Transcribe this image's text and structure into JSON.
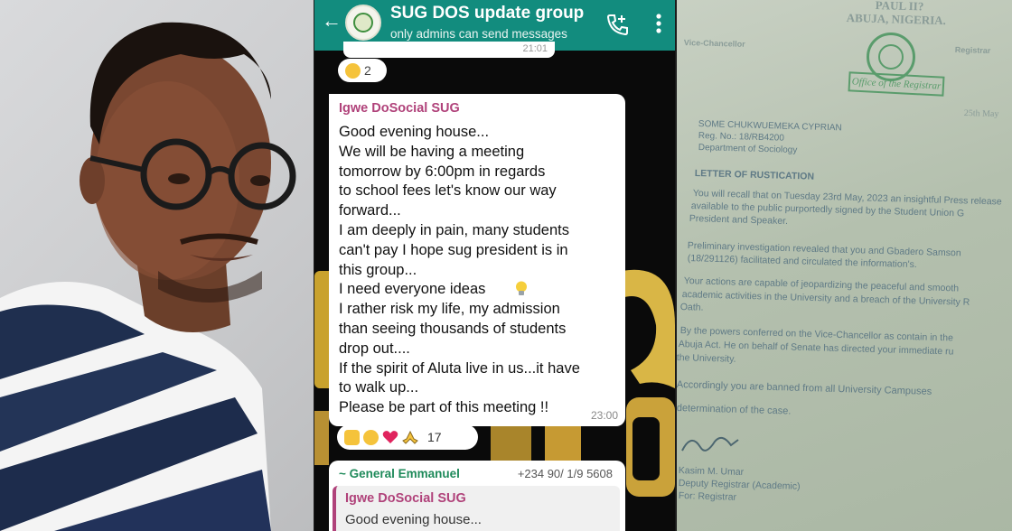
{
  "chat": {
    "header": {
      "group_name": "SUG DOS update group",
      "subtitle": "only admins can send messages"
    },
    "previous_message": {
      "time": "21:01"
    },
    "previous_reactions": {
      "emoji": "laughing-tears",
      "count": "2"
    },
    "message": {
      "sender": "Igwe DoSocial SUG",
      "text": "Good evening house...\nWe will be having a meeting\ntomorrow by 6:00pm in regards\nto school fees let's know our way\nforward...\nI am deeply in pain, many students\ncan't pay I hope sug president is in\nthis group...\nI need everyone ideas\nI rather risk my life, my admission\nthan seeing thousands of students\ndrop out....\nIf the spirit of Aluta live in us...it have\nto walk up...\nPlease be part of this meeting !!",
      "time": "23:00"
    },
    "reactions": {
      "emojis": [
        "thumbs-up",
        "laughing-tears",
        "heart",
        "praying-hands"
      ],
      "count": "17"
    },
    "reply": {
      "sender": "~ General Emmanuel",
      "phone": "+234 90/ 1/9 5608",
      "quoted_sender": "Igwe DoSocial SUG",
      "quoted_text": "Good evening house..."
    }
  },
  "letter": {
    "header_right": "PAUL II?",
    "city": "ABUJA, NIGERIA.",
    "office_stamp": "Office of the Registrar",
    "left_title": "Vice-Chancellor",
    "right_title": "Registrar",
    "date": "25th May",
    "addressee_name": "SOME CHUKWUEMEKA CYPRIAN",
    "reg_no": "Reg. No.: 18/RB4200",
    "department": "Department of Sociology",
    "subject": "LETTER OF RUSTICATION",
    "para1": [
      "You will recall that on Tuesday 23rd May, 2023 an insightful Press release",
      "available to the public purportedly signed by the Student Union G",
      "President and Speaker."
    ],
    "para2": [
      "Preliminary investigation revealed that you and Gbadero Samson",
      "(18/291126) facilitated and circulated the information's."
    ],
    "para3": [
      "Your actions are capable of jeopardizing the peaceful and smooth",
      "academic activities in the University and a breach of the University R",
      "Oath."
    ],
    "para4": [
      "By the powers conferred on the Vice-Chancellor as contain in the",
      "Abuja Act. He on behalf of Senate has directed your immediate ru",
      "the University."
    ],
    "para5": [
      "Accordingly you are banned from all University Campuses",
      "determination of the case."
    ],
    "signatory_name": "Kasim M. Umar",
    "signatory_title": "Deputy Registrar (Academic)",
    "signatory_for": "For: Registrar"
  },
  "colors": {
    "whatsapp_header": "#128c7e",
    "sender_pink": "#b0427a",
    "reply_green": "#1e8a5a",
    "stamp_green": "#5a9c6c"
  }
}
